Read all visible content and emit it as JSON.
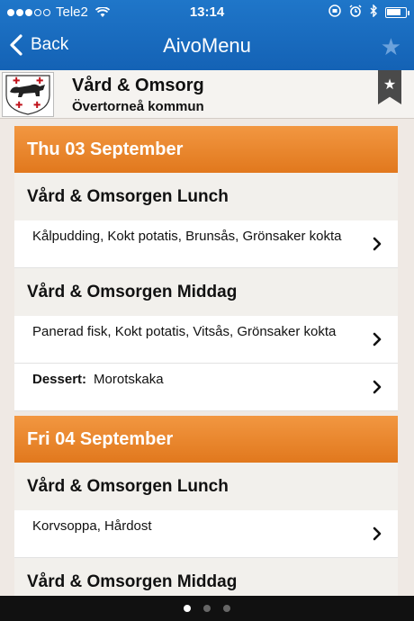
{
  "status": {
    "carrier": "Tele2",
    "time": "13:14",
    "battery_level": 0.8
  },
  "nav": {
    "back_label": "Back",
    "title": "AivoMenu",
    "favorite_icon": "star-icon"
  },
  "org": {
    "name": "Vård & Omsorg",
    "municipality": "Övertorneå kommun",
    "bookmark_icon": "star-icon"
  },
  "days": [
    {
      "date": "Thu 03 September",
      "meals": [
        {
          "title": "Vård & Omsorgen Lunch",
          "rows": [
            {
              "text": "Kålpudding, Kokt potatis, Brunsås, Grönsaker kokta"
            }
          ]
        },
        {
          "title": "Vård & Omsorgen Middag",
          "rows": [
            {
              "text": "Panerad fisk, Kokt potatis, Vitsås, Grönsaker kokta"
            },
            {
              "label": "Dessert:",
              "text": "Morotskaka"
            }
          ]
        }
      ]
    },
    {
      "date": "Fri 04 September",
      "meals": [
        {
          "title": "Vård & Omsorgen Lunch",
          "rows": [
            {
              "text": "Korvsoppa, Hårdost"
            }
          ]
        },
        {
          "title": "Vård & Omsorgen Middag",
          "rows": []
        }
      ]
    }
  ],
  "pager": {
    "pages": 3,
    "active": 0
  }
}
